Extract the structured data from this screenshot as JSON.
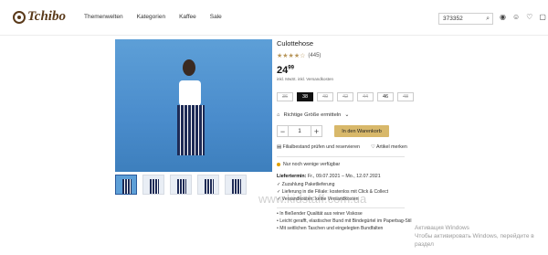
{
  "header": {
    "logo": "Tchibo",
    "nav": [
      "Themenwelten",
      "Kategorien",
      "Kaffee",
      "Sale"
    ],
    "search_value": "373352"
  },
  "product": {
    "title": "Culottehose",
    "stars": "★★★★☆",
    "reviews": "(445)",
    "price_main": "24",
    "price_cents": "99",
    "tax_note": "inkl. MwSt. inkl. Versandkosten",
    "sizes": [
      {
        "label": "36",
        "state": "na"
      },
      {
        "label": "38",
        "state": "selected"
      },
      {
        "label": "40",
        "state": "na"
      },
      {
        "label": "42",
        "state": "na"
      },
      {
        "label": "44",
        "state": "na"
      },
      {
        "label": "46",
        "state": "available"
      },
      {
        "label": "48",
        "state": "na"
      }
    ],
    "size_help": "Richtige Größe ermitteln",
    "quantity": "1",
    "cart_label": "In den Warenkorb",
    "store_link": "Filialbestand prüfen und reservieren",
    "remember_link": "Artikel merken",
    "availability": "Nur noch wenige verfügbar",
    "delivery_label": "Liefertermin:",
    "delivery_value": "Fr., 09.07.2021 – Mo., 12.07.2021",
    "checks": [
      "✓ Zuzahlung Paketlieferung",
      "✓ Lieferung in die Filiale: kostenlos mit Click & Collect",
      "✓ Versandkosten: keine Versandkosten"
    ],
    "bullets": [
      "• In fließender Qualität aus reiner Viskose",
      "• Leicht gerafft, elastischer Bund mit Bindegürtel im Paperbag-Stil",
      "• Mit seitlichen Taschen und eingelegten Bundfalten"
    ]
  },
  "overlay": {
    "watermark": "www.kidstaff.com.ua",
    "activation_line1": "Активация Windows",
    "activation_line2": "Чтобы активировать Windows, перейдите в раздел"
  },
  "colors": {
    "accent": "#d8b86a",
    "hero": "#5d9fd7",
    "stars": "#b8965a"
  }
}
